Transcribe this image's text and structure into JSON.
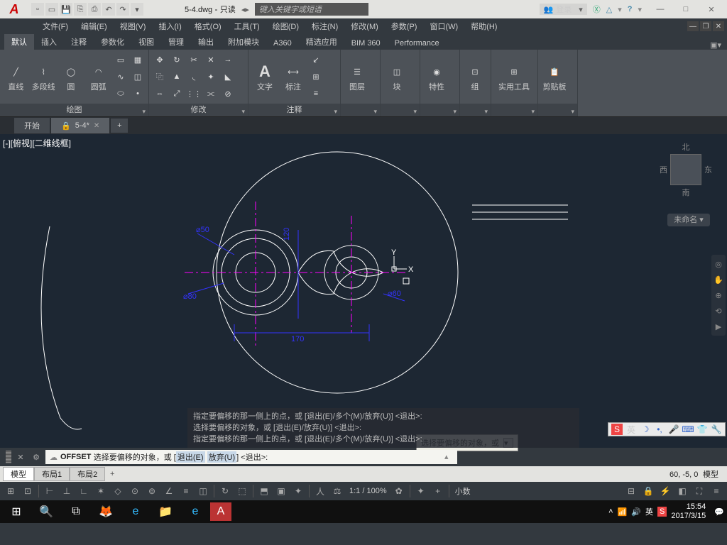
{
  "title": {
    "filename": "5-4.dwg",
    "readonly": "只读",
    "search_placeholder": "键入关键字或短语",
    "login": "登录"
  },
  "menus": [
    "文件(F)",
    "编辑(E)",
    "视图(V)",
    "插入(I)",
    "格式(O)",
    "工具(T)",
    "绘图(D)",
    "标注(N)",
    "修改(M)",
    "参数(P)",
    "窗口(W)",
    "帮助(H)"
  ],
  "ribbon_tabs": [
    "默认",
    "插入",
    "注释",
    "参数化",
    "视图",
    "管理",
    "输出",
    "附加模块",
    "A360",
    "精选应用",
    "BIM 360",
    "Performance"
  ],
  "panels": {
    "draw": {
      "title": "绘图",
      "btns": {
        "line": "直线",
        "pline": "多段线",
        "circle": "圆",
        "arc": "圆弧"
      }
    },
    "modify": {
      "title": "修改"
    },
    "annotate": {
      "title": "注释",
      "btns": {
        "text": "文字",
        "dim": "标注"
      }
    },
    "layers": {
      "title": "图层"
    },
    "block": {
      "title": "块"
    },
    "props": {
      "title": "特性"
    },
    "group": {
      "title": "组"
    },
    "util": {
      "title": "实用工具"
    },
    "clip": {
      "title": "剪贴板"
    }
  },
  "filetabs": {
    "start": "开始",
    "current": "5-4*"
  },
  "viewport": "[-][俯视][二维线框]",
  "viewcube": {
    "n": "北",
    "s": "南",
    "e": "东",
    "w": "西"
  },
  "unnamed": "未命名 ▾",
  "tooltip": "选择要偏移的对象，或",
  "history": [
    "指定要偏移的那一侧上的点，或 [退出(E)/多个(M)/放弃(U)] <退出>:",
    "选择要偏移的对象，或 [退出(E)/放弃(U)] <退出>:",
    "指定要偏移的那一侧上的点，或 [退出(E)/多个(M)/放弃(U)] <退出>:"
  ],
  "cmdline": {
    "cmd": "OFFSET",
    "prompt": "选择要偏移的对象，或 [",
    "e": "退出(E)",
    "u": "放弃(U)",
    "tail": "] <退出>:"
  },
  "layouts": {
    "model": "模型",
    "l1": "布局1",
    "l2": "布局2"
  },
  "coords": "60, -5, 0",
  "space": "模型",
  "status": {
    "scale": "1:1 / 100%",
    "numtype": "小数"
  },
  "ime": {
    "lang": "英"
  },
  "taskbar": {
    "time": "15:54",
    "date": "2017/3/15",
    "lang": "英"
  }
}
